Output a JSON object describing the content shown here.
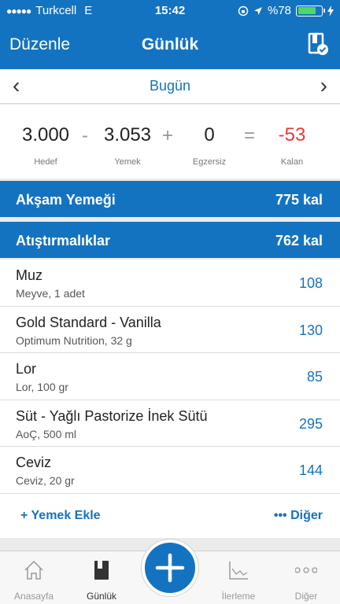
{
  "status_bar": {
    "signal": "●●●●●",
    "carrier": "Turkcell",
    "network": "E",
    "time": "15:42",
    "battery": "%78",
    "battery_level": 0.78
  },
  "nav": {
    "left": "Düzenle",
    "title": "Günlük"
  },
  "date": {
    "prev": "‹",
    "label": "Bugün",
    "next": "›"
  },
  "summary": {
    "goal": {
      "value": "3.000",
      "label": "Hedef"
    },
    "food": {
      "value": "3.053",
      "label": "Yemek"
    },
    "exercise": {
      "value": "0",
      "label": "Egzersiz"
    },
    "remaining": {
      "value": "-53",
      "label": "Kalan"
    },
    "minus": "-",
    "plus": "+",
    "equals": "="
  },
  "sections": [
    {
      "name": "Akşam Yemeği",
      "kal": "775 kal"
    },
    {
      "name": "Atıştırmalıklar",
      "kal": "762 kal"
    }
  ],
  "items": [
    {
      "name": "Muz",
      "desc": "Meyve, 1 adet",
      "cal": "108"
    },
    {
      "name": "Gold Standard - Vanilla",
      "desc": "Optimum Nutrition, 32 g",
      "cal": "130"
    },
    {
      "name": "Lor",
      "desc": "Lor, 100 gr",
      "cal": "85"
    },
    {
      "name": "Süt - Yağlı Pastorize İnek Sütü",
      "desc": "AoÇ, 500 ml",
      "cal": "295"
    },
    {
      "name": "Ceviz",
      "desc": "Ceviz, 20 gr",
      "cal": "144"
    }
  ],
  "actions": {
    "add": "+ Yemek Ekle",
    "more": "••• Diğer"
  },
  "tabs": [
    {
      "label": "Anasayfa",
      "icon": "home-icon"
    },
    {
      "label": "Günlük",
      "icon": "diary-icon"
    },
    {
      "label": "İlerleme",
      "icon": "chart-icon"
    },
    {
      "label": "Diğer",
      "icon": "more-icon"
    }
  ],
  "colors": {
    "primary": "#1473c0",
    "negative": "#e23b3b",
    "battery": "#4cd964"
  }
}
